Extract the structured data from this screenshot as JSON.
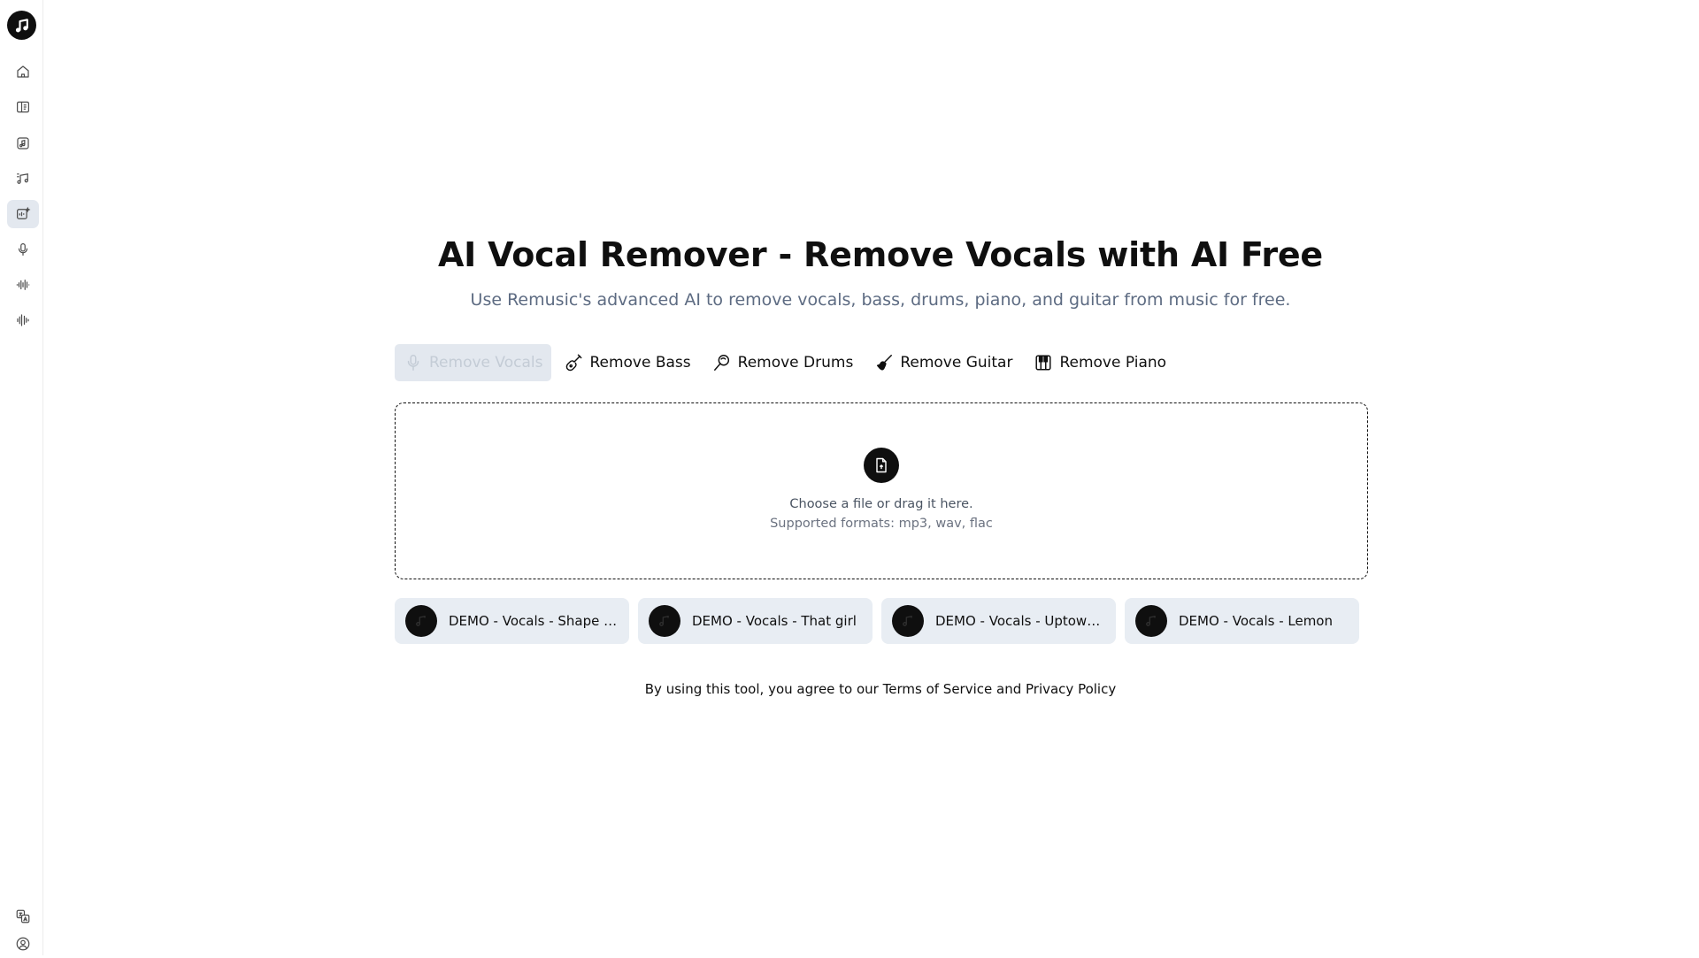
{
  "page": {
    "title": "AI Vocal Remover - Remove Vocals with AI Free",
    "subtitle": "Use Remusic's advanced AI to remove vocals, bass, drums, piano, and guitar from music for free."
  },
  "sidebar": {
    "logo_icon": "music-note-icon",
    "items": [
      {
        "icon": "home-icon"
      },
      {
        "icon": "sidebar-panel-icon"
      },
      {
        "icon": "music-file-icon"
      },
      {
        "icon": "music-notes-icon"
      },
      {
        "icon": "ai-audio-icon",
        "active": true
      },
      {
        "icon": "microphone-icon"
      },
      {
        "icon": "waveform-icon"
      },
      {
        "icon": "audio-bars-icon"
      }
    ],
    "bottom": [
      {
        "icon": "translate-icon"
      },
      {
        "icon": "user-circle-icon"
      }
    ]
  },
  "tabs": [
    {
      "label": "Remove Vocals",
      "icon": "microphone-icon",
      "active": true
    },
    {
      "label": "Remove Bass",
      "icon": "bass-guitar-icon"
    },
    {
      "label": "Remove Drums",
      "icon": "drum-icon"
    },
    {
      "label": "Remove Guitar",
      "icon": "guitar-icon"
    },
    {
      "label": "Remove Piano",
      "icon": "piano-icon"
    }
  ],
  "dropzone": {
    "icon": "upload-file-icon",
    "line1": "Choose a file or drag it here.",
    "line2": "Supported formats: mp3, wav, flac"
  },
  "demos": [
    {
      "label": "DEMO - Vocals - Shape o..."
    },
    {
      "label": "DEMO - Vocals - That girl"
    },
    {
      "label": "DEMO - Vocals - Uptown ..."
    },
    {
      "label": "DEMO - Vocals - Lemon"
    }
  ],
  "footer": {
    "prefix": "By using this tool, you agree to our ",
    "terms": "Terms of Service",
    "and": " and ",
    "privacy": "Privacy Policy"
  },
  "colors": {
    "accent": "#0f0f0f",
    "active_bg": "#e3e8ef",
    "demo_bg": "#e8edf3",
    "subtitle": "#5d6b82"
  }
}
